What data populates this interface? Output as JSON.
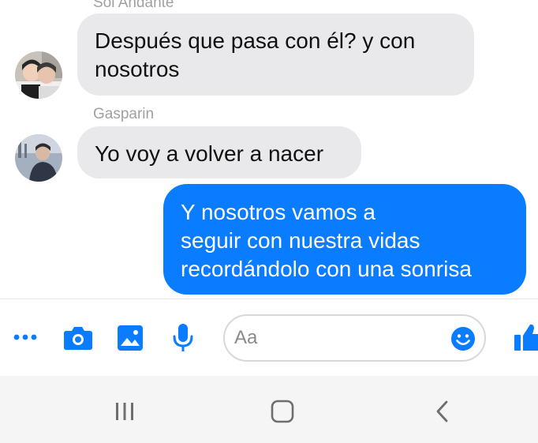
{
  "conversation": {
    "messages": [
      {
        "sender": "Sol Andante",
        "direction": "incoming",
        "lines": [
          "Después que pasa con él? y con",
          "nosotros"
        ]
      },
      {
        "sender": "Gasparin",
        "direction": "incoming",
        "lines": [
          "Yo voy a volver a nacer"
        ]
      },
      {
        "direction": "outgoing",
        "lines": [
          "Y nosotros vamos a",
          "seguir con nuestra vidas",
          "recordándolo con una sonrisa"
        ]
      }
    ]
  },
  "composer": {
    "icons": [
      "more-icon",
      "camera-icon",
      "image-icon",
      "microphone-icon",
      "emoji-icon",
      "like-icon"
    ],
    "placeholder": "Aa"
  },
  "navbar": {
    "icons": [
      "recent-apps-icon",
      "home-icon",
      "back-icon"
    ]
  },
  "colors": {
    "accent": "#0a7cff",
    "incoming_bubble": "#e9e9eb",
    "sender_name": "#a0a0a0"
  }
}
